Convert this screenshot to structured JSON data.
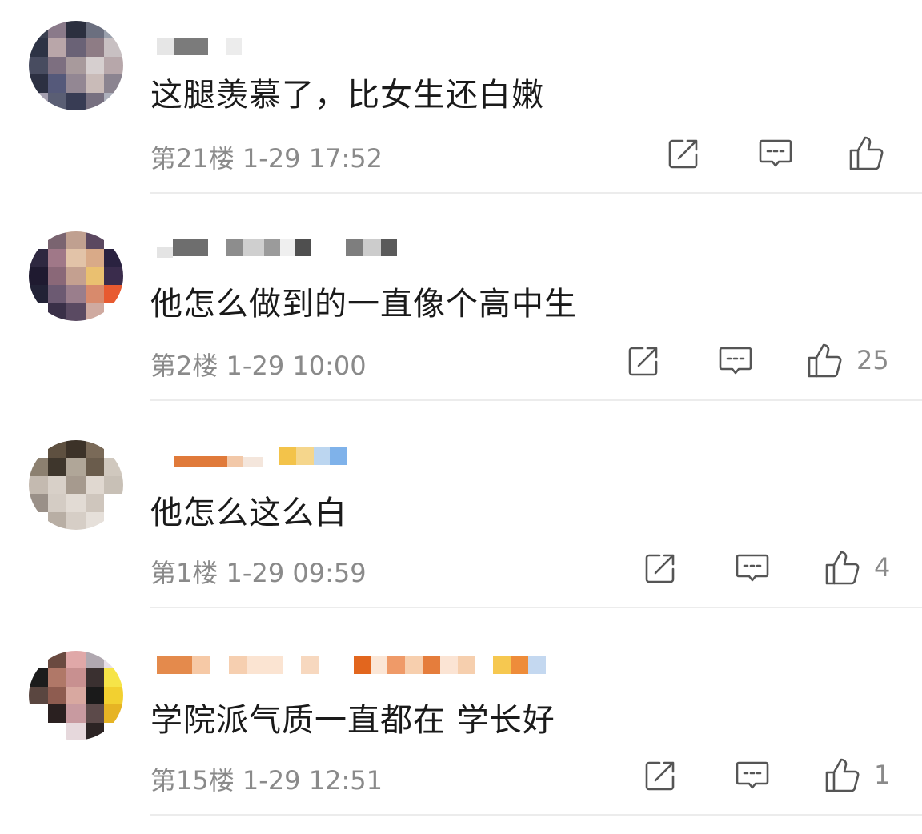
{
  "comments": [
    {
      "text": "这腿羡慕了，比女生还白嫩",
      "floor": "第21楼",
      "time": "1-29 17:52",
      "likes": ""
    },
    {
      "text": "他怎么做到的一直像个高中生",
      "floor": "第2楼",
      "time": "1-29 10:00",
      "likes": "25"
    },
    {
      "text": "他怎么这么白",
      "floor": "第1楼",
      "time": "1-29 09:59",
      "likes": "4"
    },
    {
      "text": "学院派气质一直都在 学长好",
      "floor": "第15楼",
      "time": "1-29 12:51",
      "likes": "1"
    }
  ],
  "icons": {
    "share": "share-icon",
    "reply": "comment-icon",
    "like": "thumbs-up-icon"
  },
  "colors": {
    "text": "#1a1a1a",
    "meta": "#8a8a8a",
    "icon": "#555555",
    "divider": "#ececec"
  }
}
